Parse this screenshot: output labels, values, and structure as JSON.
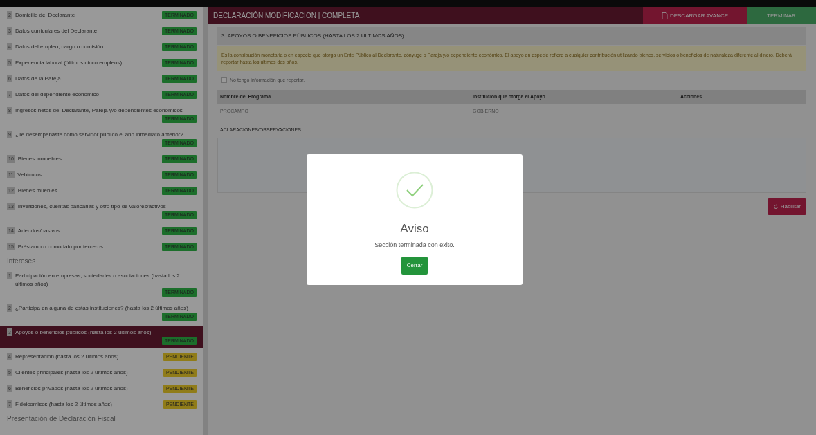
{
  "sidebar": {
    "groups": [
      {
        "items": [
          {
            "number": "2",
            "label": "Domicilio del Declarante",
            "color": "#1c6e2c",
            "status_label": "TERMINADO",
            "selected": false
          },
          {
            "number": "3",
            "label": "Datos curriculares del Declarante",
            "color": "#1c6e2c",
            "status_label": "TERMINADO",
            "selected": false
          },
          {
            "number": "4",
            "label": "Datos del empleo, cargo o comisión",
            "color": "#1c6e2c",
            "status_label": "TERMINADO",
            "selected": false
          },
          {
            "number": "5",
            "label": "Experiencia laboral (últimos cinco empleos)",
            "color": "#1c6e2c",
            "status_label": "TERMINADO",
            "selected": false
          },
          {
            "number": "6",
            "label": "Datos de la Pareja",
            "color": "#1c6e2c",
            "status_label": "TERMINADO",
            "selected": false
          },
          {
            "number": "7",
            "label": "Datos del dependiente económico",
            "color": "#1c6e2c",
            "status_label": "TERMINADO",
            "selected": false
          },
          {
            "number": "8",
            "label": "Ingresos netos del Declarante, Pareja y/o dependientes económicos",
            "color": "#1c6e2c",
            "status_label": "TERMINADO",
            "selected": false
          },
          {
            "number": "9",
            "label": "¿Te desempeñaste como servidor público el año inmediato anterior?",
            "color": "#1c6e2c",
            "status_label": "TERMINADO",
            "selected": false
          },
          {
            "number": "10",
            "label": "Bienes inmuebles",
            "color": "#1c6e2c",
            "status_label": "TERMINADO",
            "selected": false
          },
          {
            "number": "11",
            "label": "Vehículos",
            "color": "#1c6e2c",
            "status_label": "TERMINADO",
            "selected": false
          },
          {
            "number": "12",
            "label": "Bienes muebles",
            "color": "#1c6e2c",
            "status_label": "TERMINADO",
            "selected": false
          },
          {
            "number": "13",
            "label": "Inversiones, cuentas bancarias y otro tipo de valores/activos",
            "color": "#1c6e2c",
            "status_label": "TERMINADO",
            "selected": false
          },
          {
            "number": "14",
            "label": "Adeudos/pasivos",
            "color": "#1c6e2c",
            "status_label": "TERMINADO",
            "selected": false
          },
          {
            "number": "15",
            "label": "Préstamo o comodato por terceros",
            "color": "#1c6e2c",
            "status_label": "TERMINADO",
            "selected": false
          }
        ]
      },
      {
        "heading": "Intereses",
        "items": [
          {
            "number": "1",
            "label": "Participación en empresas, sociedades o asociaciones (hasta los 2 últimos años)",
            "color": "#1c6e2c",
            "status_label": "TERMINADO",
            "selected": false
          },
          {
            "number": "2",
            "label": "¿Participa en alguna de estas instituciones? (hasta los 2 últimos años)",
            "color": "#1c6e2c",
            "status_label": "TERMINADO",
            "selected": false
          },
          {
            "number": "3",
            "label": "Apoyos o beneficios públicos (hasta los 2 últimos años)",
            "color": "#1c6e2c",
            "status_label": "TERMINADO",
            "selected": true
          },
          {
            "number": "4",
            "label": "Representación (hasta los 2 últimos años)",
            "color": "#907c19",
            "status_label": "PENDIENTE",
            "selected": false
          },
          {
            "number": "5",
            "label": "Clientes principales (hasta los 2 últimos años)",
            "color": "#907c19",
            "status_label": "PENDIENTE",
            "selected": false
          },
          {
            "number": "6",
            "label": "Beneficios privados (hasta los 2 últimos años)",
            "color": "#907c19",
            "status_label": "PENDIENTE",
            "selected": false
          },
          {
            "number": "7",
            "label": "Fideicomisos (hasta los 2 últimos años)",
            "color": "#907c19",
            "status_label": "PENDIENTE",
            "selected": false
          }
        ]
      },
      {
        "heading": "Presentación de Declaración Fiscal"
      }
    ]
  },
  "header": {
    "title": "DECLARACIÓN MODIFICACION | COMPLETA",
    "download_button": "DESCARGAR AVANCE",
    "finish_button": "TERMINAR"
  },
  "section": {
    "title": "3. APOYOS O BENEFICIOS PÚBLICOS (HASTA LOS 2 ÚLTIMOS AÑOS)",
    "note": "Es la contribución monetaria o en especie que otorga un Ente Público al Declarante, cónyuge o Pareja y/o dependiente económico. El apoyo en especie refiere a cualquier contribución utilizando bienes, servicios o beneficios de naturaleza diferente al dinero. Deberá reportar hasta los últimos dos años.",
    "no_info": {
      "label": "No tengo información que reportar.",
      "checked": false
    },
    "table": {
      "columns": [
        "Nombre del Programa",
        "Institución que otorga el Apoyo",
        "Acciones"
      ],
      "rows": [
        [
          "PROCAMPO",
          "GOBIERNO"
        ]
      ]
    },
    "remarks_label": "ACLARACIONES/OBSERVACIONES",
    "enable_button": "Habilitar"
  },
  "modal": {
    "title": "Aviso",
    "message": "Sección terminada con exito.",
    "button": "Cerrar"
  }
}
